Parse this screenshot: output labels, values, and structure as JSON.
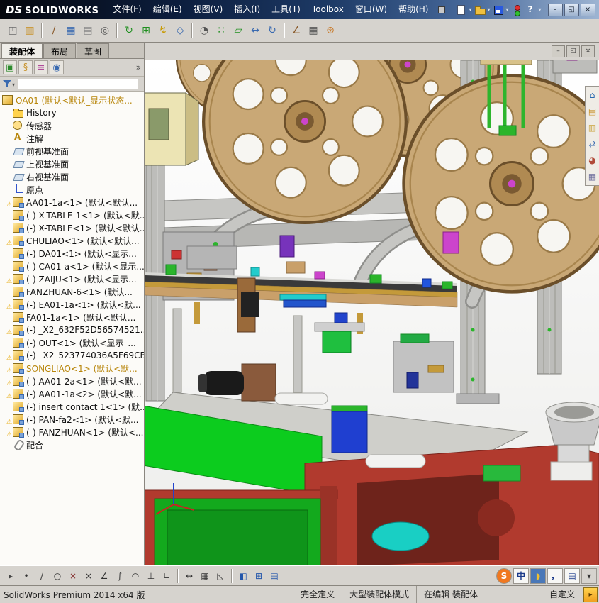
{
  "titlebar": {
    "logo_prefix": "DS",
    "logo_text": "SOLIDWORKS",
    "menus": [
      "文件(F)",
      "编辑(E)",
      "视图(V)",
      "插入(I)",
      "工具(T)",
      "Toolbox",
      "窗口(W)",
      "帮助(H)"
    ],
    "icons": [
      {
        "name": "new-document-icon",
        "type": "page",
        "dd": true
      },
      {
        "name": "open-document-icon",
        "type": "folder",
        "dd": true
      },
      {
        "name": "save-icon",
        "type": "floppy",
        "dd": true
      },
      {
        "name": "solidworks-search-icon",
        "type": "traffic"
      },
      {
        "name": "help-icon",
        "type": "help",
        "dd": true
      }
    ],
    "window_buttons": [
      {
        "name": "minimize-button",
        "g": "–"
      },
      {
        "name": "restore-button",
        "g": "◱"
      },
      {
        "name": "close-button",
        "g": "×"
      }
    ]
  },
  "toolbar": {
    "items": [
      {
        "name": "view-orientation-icon",
        "g": "◳",
        "fg": "#6a6a6a"
      },
      {
        "name": "open-folder-icon",
        "g": "▥",
        "fg": "#c8922a"
      },
      {
        "sep": true
      },
      {
        "name": "annotation-tool-icon",
        "g": "∕",
        "fg": "#8a5a2a"
      },
      {
        "name": "design-table-icon",
        "g": "▦",
        "fg": "#3a6ab0"
      },
      {
        "name": "find-references-icon",
        "g": "▤",
        "fg": "#8a8a8a"
      },
      {
        "name": "search-icon",
        "g": "◎",
        "fg": "#555555"
      },
      {
        "sep": true
      },
      {
        "name": "rebuild-icon",
        "g": "↻",
        "fg": "#1f8f1f"
      },
      {
        "name": "insert-component-icon",
        "g": "⊞",
        "fg": "#1f8f1f"
      },
      {
        "name": "smart-fasteners-icon",
        "g": "↯",
        "fg": "#c89a00"
      },
      {
        "name": "mate-icon",
        "g": "◇",
        "fg": "#3a6ab0"
      },
      {
        "sep": true
      },
      {
        "name": "hide-show-icon",
        "g": "◔",
        "fg": "#555555"
      },
      {
        "name": "linear-pattern-icon",
        "g": "∷",
        "fg": "#1f8f1f"
      },
      {
        "name": "edit-component-icon",
        "g": "▱",
        "fg": "#1f8f1f"
      },
      {
        "name": "move-component-icon",
        "g": "↔",
        "fg": "#3a6ab0"
      },
      {
        "name": "rotate-component-icon",
        "g": "↻",
        "fg": "#3a6ab0"
      },
      {
        "sep": true
      },
      {
        "name": "measure-icon",
        "g": "∠",
        "fg": "#8a5a2a"
      },
      {
        "name": "bom-icon",
        "g": "▦",
        "fg": "#555555"
      },
      {
        "name": "exploded-view-icon",
        "g": "⊛",
        "fg": "#c87a2a"
      }
    ]
  },
  "left_panel": {
    "tabs": [
      {
        "name": "tab-assembly",
        "label": "装配体",
        "active": true
      },
      {
        "name": "tab-layout",
        "label": "布局",
        "active": false
      },
      {
        "name": "tab-sketch",
        "label": "草图",
        "active": false
      }
    ],
    "manager_icons": [
      {
        "name": "featuremanager-tab-icon",
        "g": "▣",
        "fg": "#2e8b2e"
      },
      {
        "name": "propertymanager-tab-icon",
        "g": "§",
        "fg": "#c8922a"
      },
      {
        "name": "configurationmanager-tab-icon",
        "g": "≡",
        "fg": "#b04a9a"
      },
      {
        "name": "displaymanager-tab-icon",
        "g": "◉",
        "fg": "#3a6ab0"
      }
    ],
    "tree": [
      {
        "icon": "assembly",
        "label": "OA01 (默认<默认_显示状态...",
        "gold": true
      },
      {
        "icon": "history",
        "label": "History"
      },
      {
        "icon": "sensor",
        "label": "传感器"
      },
      {
        "icon": "annotation",
        "label": "注解"
      },
      {
        "icon": "plane",
        "label": "前视基准面"
      },
      {
        "icon": "plane",
        "label": "上视基准面"
      },
      {
        "icon": "plane",
        "label": "右视基准面"
      },
      {
        "icon": "origin",
        "label": "原点"
      },
      {
        "w": 1,
        "icon": "component",
        "label": "AA01-1a<1> (默认<默认..."
      },
      {
        "icon": "component",
        "label": "(-) X-TABLE-1<1> (默认<默..."
      },
      {
        "icon": "component",
        "label": "(-) X-TABLE<1> (默认<默认..."
      },
      {
        "w": 1,
        "icon": "component",
        "label": "CHULIAO<1> (默认<默认..."
      },
      {
        "icon": "component",
        "label": "(-) DA01<1> (默认<显示..."
      },
      {
        "icon": "component",
        "label": "(-) CA01-a<1> (默认<显示..."
      },
      {
        "w": 1,
        "icon": "component",
        "label": "(-) ZAIJU<1> (默认<显示..."
      },
      {
        "icon": "component",
        "label": "FANZHUAN-6<1> (默认..."
      },
      {
        "w": 1,
        "icon": "component",
        "label": "(-) EA01-1a<1> (默认<默..."
      },
      {
        "icon": "component",
        "label": "FA01-1a<1> (默认<默认..."
      },
      {
        "w": 1,
        "icon": "component",
        "label": "(-) _X2_632F52D56574521..."
      },
      {
        "icon": "component",
        "label": "(-) OUT<1> (默认<显示_..."
      },
      {
        "w": 1,
        "icon": "component",
        "label": "(-) _X2_523774036A5F69CB_..."
      },
      {
        "w": 1,
        "icon": "component",
        "label": "SONGLIAO<1> (默认<默...",
        "gold": true
      },
      {
        "w": 1,
        "icon": "component",
        "label": "(-) AA01-2a<1> (默认<默..."
      },
      {
        "w": 1,
        "icon": "component",
        "label": "(-) AA01-1a<2> (默认<默..."
      },
      {
        "icon": "component",
        "label": "(-) insert contact 1<1> (默..."
      },
      {
        "w": 1,
        "icon": "component",
        "label": "(-) PAN-fa2<1> (默认<默..."
      },
      {
        "w": 1,
        "icon": "component",
        "label": "(-) FANZHUAN<1> (默认<..."
      },
      {
        "icon": "mates",
        "label": "配合"
      }
    ]
  },
  "viewport": {
    "doc_controls": [
      {
        "name": "doc-minimize-button",
        "g": "–"
      },
      {
        "name": "doc-restore-button",
        "g": "◱"
      },
      {
        "name": "doc-close-button",
        "g": "×"
      }
    ],
    "task_pane": [
      {
        "name": "solidworks-resources-icon",
        "g": "⌂",
        "fg": "#2a6ab0"
      },
      {
        "name": "design-library-icon",
        "g": "▤",
        "fg": "#c8922a"
      },
      {
        "name": "file-explorer-icon",
        "g": "▥",
        "fg": "#c8a23a"
      },
      {
        "name": "view-palette-icon",
        "g": "⇄",
        "fg": "#3a6ab0"
      },
      {
        "name": "appearances-icon",
        "g": "◕",
        "fg": "#b04a3a"
      },
      {
        "name": "custom-properties-icon",
        "g": "▦",
        "fg": "#6a6a9a"
      }
    ]
  },
  "bottombar": {
    "items": [
      {
        "name": "toolbar-overflow-icon",
        "g": "▸",
        "fg": "#444444"
      },
      {
        "name": "point-icon",
        "g": "•",
        "fg": "#333333"
      },
      {
        "name": "line-icon",
        "g": "∕",
        "fg": "#333333"
      },
      {
        "name": "circle-icon",
        "g": "○",
        "fg": "#333333"
      },
      {
        "name": "erase-icon",
        "g": "×",
        "fg": "#8a3a3a"
      },
      {
        "name": "trim-icon",
        "g": "×",
        "fg": "#333333"
      },
      {
        "name": "angle-icon",
        "g": "∠",
        "fg": "#333333"
      },
      {
        "name": "spline-icon",
        "g": "∫",
        "fg": "#333333"
      },
      {
        "name": "arc-icon",
        "g": "◠",
        "fg": "#333333"
      },
      {
        "name": "perpendicular-icon",
        "g": "⊥",
        "fg": "#333333"
      },
      {
        "name": "corner-rectangle-icon",
        "g": "∟",
        "fg": "#333333"
      },
      {
        "sep": true
      },
      {
        "name": "smart-dimension-icon",
        "g": "↔",
        "fg": "#333333"
      },
      {
        "name": "grid-icon",
        "g": "▦",
        "fg": "#333333"
      },
      {
        "name": "draft-icon",
        "g": "◺",
        "fg": "#333333"
      },
      {
        "sep": true
      },
      {
        "name": "section-view-icon",
        "g": "◧",
        "fg": "#2255aa"
      },
      {
        "name": "viewport-pane-icon",
        "g": "⊞",
        "fg": "#2255aa"
      },
      {
        "name": "table-icon",
        "g": "▤",
        "fg": "#2255aa"
      }
    ],
    "language_bar": [
      {
        "name": "sogou-input-icon",
        "g": "S",
        "fg": "#ffffff",
        "bg": "#f07820",
        "round": true
      },
      {
        "name": "chinese-mode-icon",
        "g": "中",
        "fg": "#1a3a8a",
        "bg": "#f7f7f5"
      },
      {
        "name": "halfwidth-icon",
        "g": "◗",
        "fg": "#f0c030",
        "bg": "#4a78b8"
      },
      {
        "name": "punctuation-icon",
        "g": "，",
        "fg": "#1a3a8a",
        "bg": "#f7f7f5"
      },
      {
        "name": "soft-keyboard-icon",
        "g": "▤",
        "fg": "#1a3a8a",
        "bg": "#f7f7f5"
      },
      {
        "name": "language-options-icon",
        "g": "▾",
        "fg": "#333333",
        "bg": "#d6d3ce"
      }
    ]
  },
  "statusbar": {
    "left": "SolidWorks Premium 2014 x64 版",
    "fields": [
      "完全定义",
      "大型装配体模式",
      "在编辑 装配体"
    ],
    "customize": "自定义",
    "corner_glyph": "▸"
  },
  "colors": {
    "titlebar_blue": "#2c4f82",
    "toolbar_bg": "#d6d3ce",
    "warning_yellow": "#e6a700",
    "table_green": "#0ccc1e",
    "frame_red": "#b13a2e",
    "reel_tan": "#c9a876"
  }
}
